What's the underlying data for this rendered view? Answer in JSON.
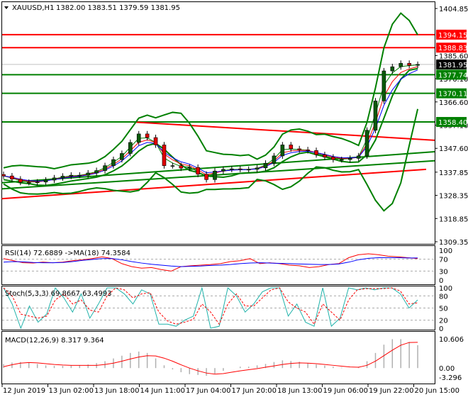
{
  "header": {
    "symbol": "XAUUSD,H1",
    "ohlc": "1382.00 1383.51 1379.59 1381.95"
  },
  "colors": {
    "bull": "#0a5a0a",
    "bear": "#e00000",
    "level_red": "#ff0000",
    "level_green": "#008000",
    "current": "#000000",
    "band": "#008000",
    "ma_fast": "#008000",
    "ma_mid": "#ff0000",
    "ma_slow": "#0000ff"
  },
  "chart_data": [
    {
      "type": "candlestick",
      "title": "XAUUSD,H1",
      "ylim": [
        1309.35,
        1404.85
      ],
      "y_ticks": [
        "1404.85",
        "1385.60",
        "1376.10",
        "1366.60",
        "1357.10",
        "1347.60",
        "1337.85",
        "1328.35",
        "1318.85",
        "1309.35"
      ],
      "closes": [
        1336.3,
        1335,
        1333.7,
        1333.6,
        1333.8,
        1334.6,
        1335.5,
        1336.2,
        1336.6,
        1336.6,
        1337.5,
        1338.5,
        1340.5,
        1343,
        1345.5,
        1350,
        1353.5,
        1352,
        1349,
        1340.5,
        1340.5,
        1339.5,
        1339.8,
        1337,
        1334.8,
        1338.3,
        1339,
        1339.2,
        1339,
        1339,
        1339.6,
        1341.5,
        1344.5,
        1349,
        1347.4,
        1347,
        1346.7,
        1345,
        1344,
        1343,
        1343,
        1343.5,
        1344.5,
        1355,
        1367,
        1379.3,
        1381,
        1382.4,
        1381.6,
        1381.95
      ],
      "levels": [
        {
          "label": "1394.15",
          "value": 1394.15,
          "color": "red"
        },
        {
          "label": "1388.83",
          "value": 1388.83,
          "color": "red"
        },
        {
          "label": "1381.95",
          "value": 1381.95,
          "color": "current"
        },
        {
          "label": "1377.74",
          "value": 1377.74,
          "color": "green"
        },
        {
          "label": "1370.11",
          "value": 1370.11,
          "color": "green"
        },
        {
          "label": "1358.40",
          "value": 1358.4,
          "color": "green"
        }
      ],
      "trendlines": [
        {
          "name": "resistance-trendline",
          "from": [
            15.7,
            1358.3
          ],
          "to": [
            52,
            1350.9
          ],
          "color": "red"
        },
        {
          "name": "support-trendline-upper",
          "from": [
            -0.2,
            1333.5
          ],
          "to": [
            52,
            1346.2
          ],
          "color": "green"
        },
        {
          "name": "support-trendline-lower",
          "from": [
            -0.2,
            1331.0
          ],
          "to": [
            52,
            1342.5
          ],
          "color": "green"
        },
        {
          "name": "long-trendline",
          "from": [
            -0.2,
            1327.0
          ],
          "to": [
            50,
            1339.0
          ],
          "color": "red"
        }
      ]
    },
    {
      "type": "line",
      "title": "RSI(14) 72.6889  ->MA(18) 74.3584",
      "ylim": [
        0,
        100
      ],
      "y_ticks": [
        "100",
        "70",
        "30",
        "0"
      ],
      "levels": [
        70,
        30
      ],
      "series": [
        {
          "name": "RSI",
          "values": [
            72,
            65,
            58,
            57,
            60,
            58,
            60,
            65,
            68,
            72,
            78,
            72,
            55,
            45,
            40,
            42,
            35,
            30,
            45,
            48,
            50,
            52,
            55,
            62,
            65,
            72,
            55,
            58,
            55,
            50,
            48,
            42,
            45,
            52,
            55,
            75,
            85,
            88,
            85,
            80,
            78,
            75,
            72
          ]
        },
        {
          "name": "MA",
          "values": [
            60,
            62,
            61,
            59,
            58,
            58,
            59,
            62,
            66,
            69,
            72,
            72,
            68,
            62,
            57,
            53,
            50,
            47,
            45,
            46,
            47,
            49,
            50,
            52,
            55,
            57,
            58,
            57,
            56,
            55,
            54,
            53,
            52,
            52,
            54,
            60,
            68,
            73,
            75,
            75,
            75,
            74,
            74
          ]
        }
      ]
    },
    {
      "type": "line",
      "title": "Stoch(5,3,3) 69.8667 63.4993",
      "ylim": [
        0,
        100
      ],
      "y_ticks": [
        "100",
        "80",
        "50",
        "20",
        "0"
      ],
      "levels": [
        80,
        50,
        20
      ],
      "series": [
        {
          "name": "%K",
          "values": [
            100,
            60,
            0,
            55,
            15,
            35,
            100,
            75,
            40,
            85,
            25,
            60,
            100,
            100,
            85,
            60,
            95,
            85,
            10,
            10,
            5,
            20,
            30,
            100,
            0,
            5,
            100,
            80,
            40,
            60,
            90,
            100,
            100,
            30,
            60,
            15,
            5,
            100,
            5,
            25,
            100,
            95,
            100,
            95,
            100,
            100,
            85,
            50,
            70
          ]
        },
        {
          "name": "%D",
          "values": [
            100,
            80,
            35,
            30,
            25,
            30,
            70,
            85,
            60,
            70,
            45,
            40,
            80,
            100,
            95,
            75,
            85,
            88,
            40,
            18,
            10,
            15,
            22,
            60,
            40,
            10,
            60,
            85,
            55,
            55,
            75,
            95,
            100,
            65,
            50,
            40,
            10,
            60,
            40,
            20,
            70,
            95,
            98,
            98,
            98,
            100,
            92,
            60,
            63
          ]
        }
      ]
    },
    {
      "type": "bar+line",
      "title": "MACD(12,26,9) 8.317 9.364",
      "ylim": [
        -3.296,
        10.606
      ],
      "y_ticks": [
        "10.606",
        "0.00",
        "-3.296"
      ],
      "series": [
        {
          "name": "MACD",
          "values": [
            1.5,
            2.0,
            2.2,
            2.0,
            1.5,
            1.0,
            0.8,
            0.8,
            0.9,
            1.0,
            1.3,
            1.8,
            2.5,
            3.5,
            4.5,
            5.5,
            6.0,
            5.5,
            3.5,
            1.0,
            -0.5,
            -1.5,
            -2.2,
            -2.5,
            -2.8,
            -2.0,
            -1.0,
            0.0,
            0.5,
            0.5,
            1.0,
            1.5,
            2.2,
            2.8,
            2.6,
            2.3,
            1.8,
            1.3,
            0.9,
            0.5,
            0.2,
            0.0,
            0.5,
            2.5,
            5.5,
            8.5,
            10.5,
            10.5,
            9.5,
            8.317
          ]
        },
        {
          "name": "Signal",
          "values": [
            0.5,
            1.2,
            1.8,
            2.0,
            1.9,
            1.6,
            1.3,
            1.1,
            1.0,
            1.0,
            1.0,
            1.0,
            1.3,
            1.8,
            2.5,
            3.3,
            4.0,
            4.5,
            4.4,
            3.6,
            2.5,
            1.2,
            0.0,
            -1.0,
            -1.8,
            -2.2,
            -2.0,
            -1.5,
            -1.0,
            -0.6,
            -0.2,
            0.3,
            0.8,
            1.3,
            1.7,
            1.9,
            1.8,
            1.6,
            1.3,
            1.0,
            0.7,
            0.4,
            0.3,
            1.0,
            2.5,
            4.5,
            6.5,
            8.3,
            9.3,
            9.364
          ]
        }
      ]
    }
  ],
  "time_axis": [
    "12 Jun 2019",
    "13 Jun 02:00",
    "13 Jun 18:00",
    "14 Jun 11:00",
    "17 Jun 04:00",
    "17 Jun 20:00",
    "18 Jun 13:00",
    "19 Jun 06:00",
    "19 Jun 22:00",
    "20 Jun 15:00"
  ]
}
